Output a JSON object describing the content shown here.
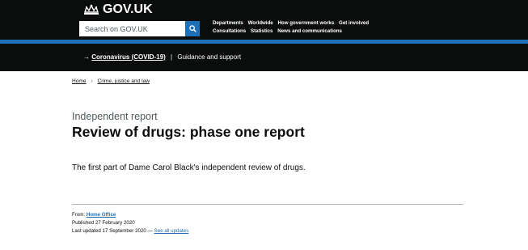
{
  "header": {
    "logo_text": "GOV.UK",
    "search_placeholder": "Search on GOV.UK",
    "nav_row1": [
      "Departments",
      "Worldwide",
      "How government works",
      "Get involved"
    ],
    "nav_row2": [
      "Consultations",
      "Statistics",
      "News and communications"
    ],
    "accent_color": "#1d70b8"
  },
  "banner": {
    "arrow": "→",
    "link": "Coronavirus (COVID-19)",
    "separator": "|",
    "text": "Guidance and support"
  },
  "breadcrumb": {
    "items": [
      "Home",
      "Crime, justice and law"
    ],
    "separator": "›"
  },
  "page": {
    "caption": "Independent report",
    "title": "Review of drugs: phase one report",
    "summary": "The first part of Dame Carol Black's independent review of drugs."
  },
  "meta": {
    "from_label": "From:",
    "from_org": "Home Office",
    "published": "Published 27 February 2020",
    "updated": "Last updated 17 September 2020 —",
    "see_all": "See all updates"
  }
}
